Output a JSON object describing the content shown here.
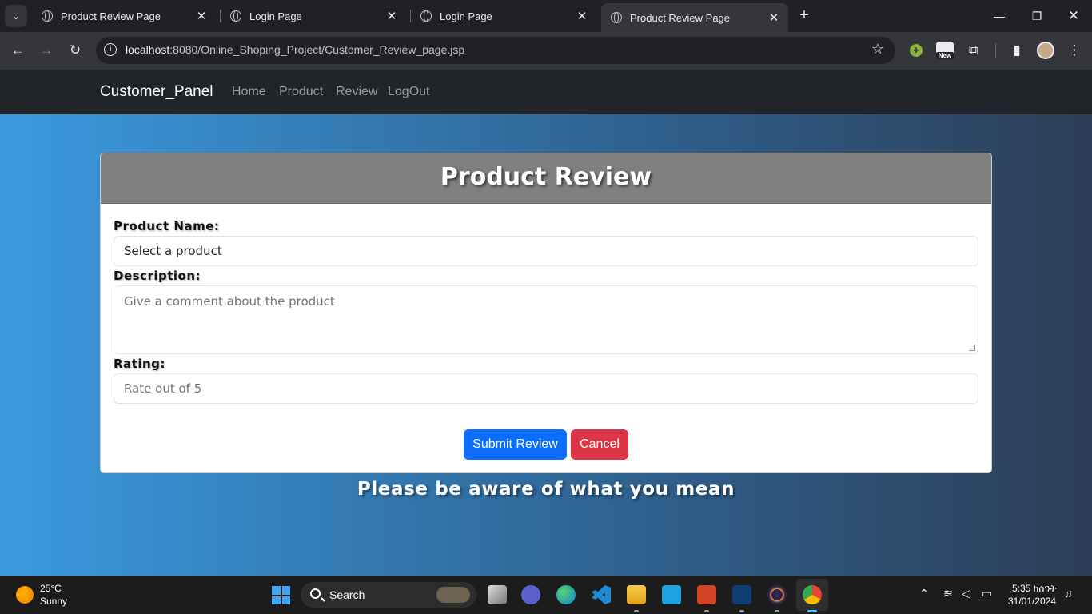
{
  "browser": {
    "tabs": [
      {
        "title": "Product Review Page",
        "active": false
      },
      {
        "title": "Login Page",
        "active": false
      },
      {
        "title": "Login Page",
        "active": false
      },
      {
        "title": "Product Review Page",
        "active": true
      }
    ],
    "url_host": "localhost",
    "url_rest": ":8080/Online_Shoping_Project/Customer_Review_page.jsp",
    "extension_badge": "New"
  },
  "navbar": {
    "brand": "Customer_Panel",
    "links": [
      "Home",
      "Product",
      "Review",
      "LogOut"
    ]
  },
  "form": {
    "title": "Product Review",
    "product_label": "Product Name:",
    "product_value": "Select a product",
    "description_label": "Description:",
    "description_placeholder": "Give a comment about the product",
    "rating_label": "Rating:",
    "rating_placeholder": "Rate out of 5",
    "submit_label": "Submit Review",
    "cancel_label": "Cancel"
  },
  "footer_note": "Please be aware of what you mean",
  "taskbar": {
    "weather_temp": "25°C",
    "weather_desc": "Sunny",
    "search_label": "Search",
    "time": "5:35 ከሰዓት",
    "date": "31/01/2024"
  },
  "colors": {
    "primary": "#0d6efd",
    "danger": "#dc3545",
    "navbar": "#212529",
    "card_header": "#808080"
  }
}
